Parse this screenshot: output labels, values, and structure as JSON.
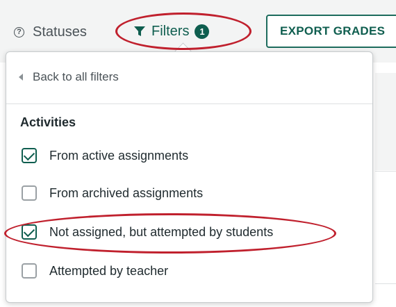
{
  "toolbar": {
    "statuses_icon": "question-circle-icon",
    "statuses_label": "Statuses",
    "filters_icon": "filter-funnel-icon",
    "filters_label": "Filters",
    "filters_count": "1",
    "export_label": "EXPORT GRADES"
  },
  "panel": {
    "back_icon": "caret-left-icon",
    "back_label": "Back to all filters",
    "section_title": "Activities",
    "options": [
      {
        "label": "From active assignments",
        "checked": true
      },
      {
        "label": "From archived assignments",
        "checked": false
      },
      {
        "label": "Not assigned, but attempted by students",
        "checked": true
      },
      {
        "label": "Attempted by teacher",
        "checked": false
      }
    ]
  },
  "colors": {
    "accent": "#0f5e4f",
    "annotation": "#c0202d",
    "border": "#c7cbcd"
  }
}
